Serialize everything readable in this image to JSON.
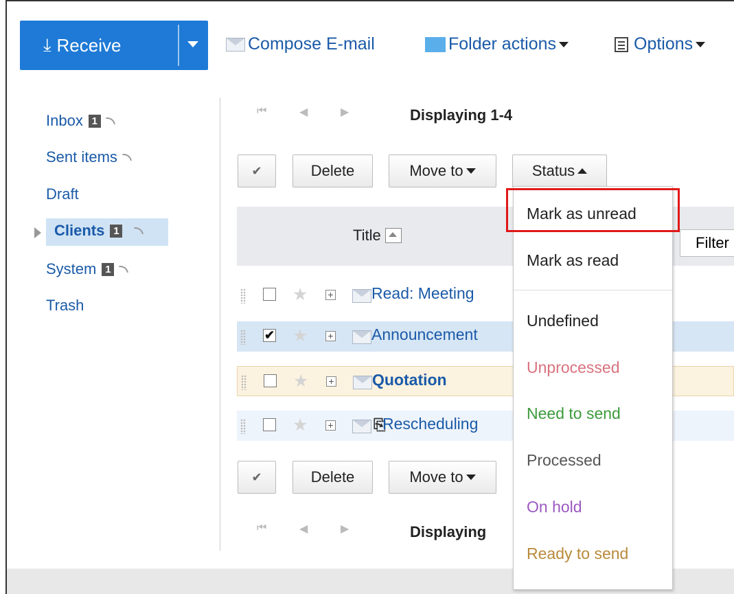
{
  "toolbar": {
    "receive_label": "Receive",
    "compose_label": "Compose E-mail",
    "folder_actions_label": "Folder actions",
    "options_label": "Options"
  },
  "sidebar": {
    "items": [
      {
        "label": "Inbox",
        "count": "1"
      },
      {
        "label": "Sent items"
      },
      {
        "label": "Draft"
      },
      {
        "label": "Clients",
        "count": "1"
      },
      {
        "label": "System",
        "count": "1"
      },
      {
        "label": "Trash"
      }
    ]
  },
  "pager": {
    "top_text": "Displaying 1-4",
    "bottom_text": "Displaying"
  },
  "actions": {
    "delete_label": "Delete",
    "move_to_label": "Move to",
    "status_label": "Status"
  },
  "table": {
    "title_header": "Title",
    "filter_label": "Filter",
    "rows": [
      {
        "subject": "Read: Meeting",
        "checked": false,
        "unread": false
      },
      {
        "subject": "Announcement",
        "checked": true,
        "unread": false
      },
      {
        "subject": "Quotation",
        "checked": false,
        "unread": true
      },
      {
        "subject": "Rescheduling",
        "checked": false,
        "unread": false,
        "attachment": true
      }
    ]
  },
  "status_menu": {
    "items": [
      {
        "label": "Mark as unread",
        "color": "#222222"
      },
      {
        "label": "Mark as read",
        "color": "#222222"
      },
      {
        "label": "Undefined",
        "color": "#222222"
      },
      {
        "label": "Unprocessed",
        "color": "#d9727e"
      },
      {
        "label": "Need to send",
        "color": "#3c9a3c"
      },
      {
        "label": "Processed",
        "color": "#555555"
      },
      {
        "label": "On hold",
        "color": "#9b59c0"
      },
      {
        "label": "Ready to send",
        "color": "#b88a3a"
      }
    ]
  },
  "colors": {
    "accent": "#1e7ad6",
    "link": "#1a5aa8",
    "highlight_box": "#e01818"
  }
}
